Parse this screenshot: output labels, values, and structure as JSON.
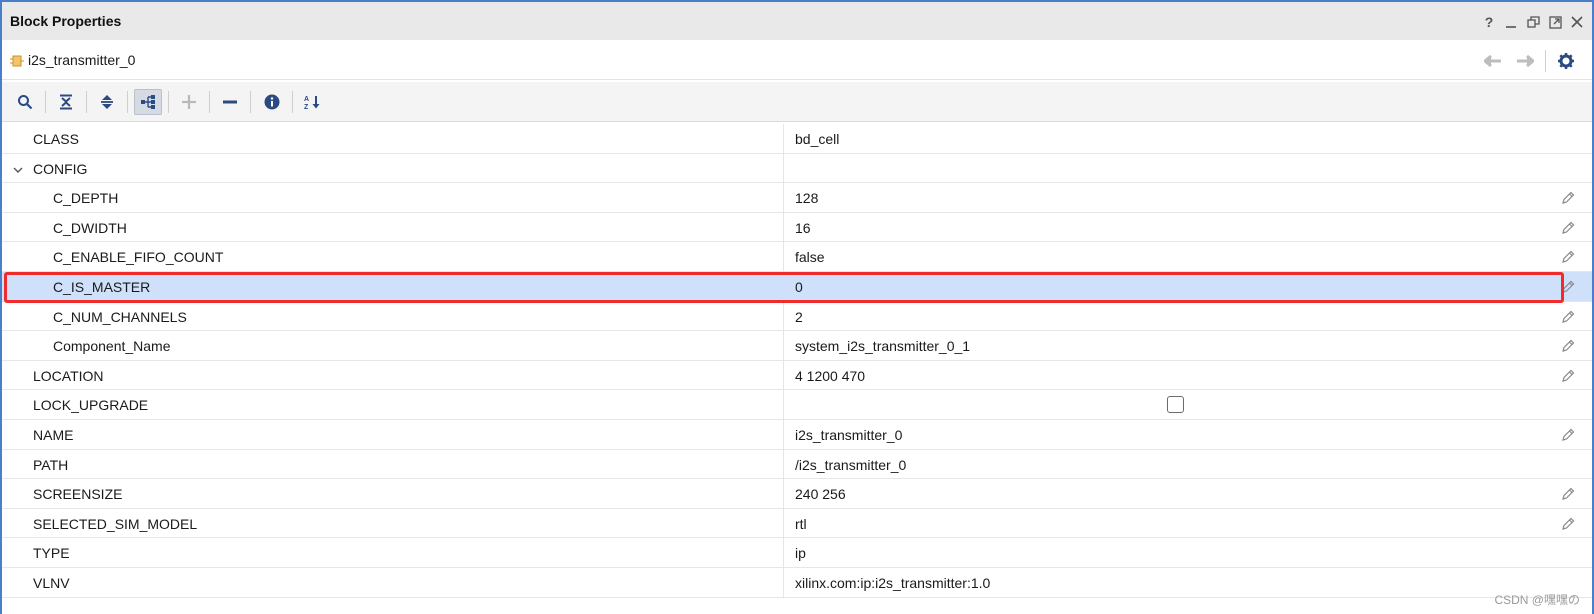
{
  "window": {
    "title": "Block Properties",
    "controls": [
      "help-icon",
      "minimize-icon",
      "restore-icon",
      "maximize-icon",
      "close-icon"
    ],
    "help_label": "?"
  },
  "object": {
    "name": "i2s_transmitter_0",
    "icon": "ip-cell-icon"
  },
  "toolbar": {
    "buttons": [
      "search-icon",
      "collapse-all-icon",
      "expand-all-icon",
      "tree-view-icon",
      "add-icon",
      "remove-icon",
      "info-icon",
      "sort-az-icon"
    ]
  },
  "colors": {
    "accent": "#4a7ec8",
    "selection": "#cfe0fb",
    "highlight": "#ef2b2b"
  },
  "properties": [
    {
      "name": "CLASS",
      "value": "bd_cell"
    },
    {
      "name": "CONFIG",
      "value": ""
    },
    {
      "name": "C_DEPTH",
      "value": "128"
    },
    {
      "name": "C_DWIDTH",
      "value": "16"
    },
    {
      "name": "C_ENABLE_FIFO_COUNT",
      "value": "false"
    },
    {
      "name": "C_IS_MASTER",
      "value": "0"
    },
    {
      "name": "C_NUM_CHANNELS",
      "value": "2"
    },
    {
      "name": "Component_Name",
      "value": "system_i2s_transmitter_0_1"
    },
    {
      "name": "LOCATION",
      "value": "4 1200 470"
    },
    {
      "name": "LOCK_UPGRADE",
      "value": ""
    },
    {
      "name": "NAME",
      "value": "i2s_transmitter_0"
    },
    {
      "name": "PATH",
      "value": "/i2s_transmitter_0"
    },
    {
      "name": "SCREENSIZE",
      "value": "240 256"
    },
    {
      "name": "SELECTED_SIM_MODEL",
      "value": "rtl"
    },
    {
      "name": "TYPE",
      "value": "ip"
    },
    {
      "name": "VLNV",
      "value": "xilinx.com:ip:i2s_transmitter:1.0"
    }
  ],
  "watermark": "CSDN @嘿嘿の"
}
